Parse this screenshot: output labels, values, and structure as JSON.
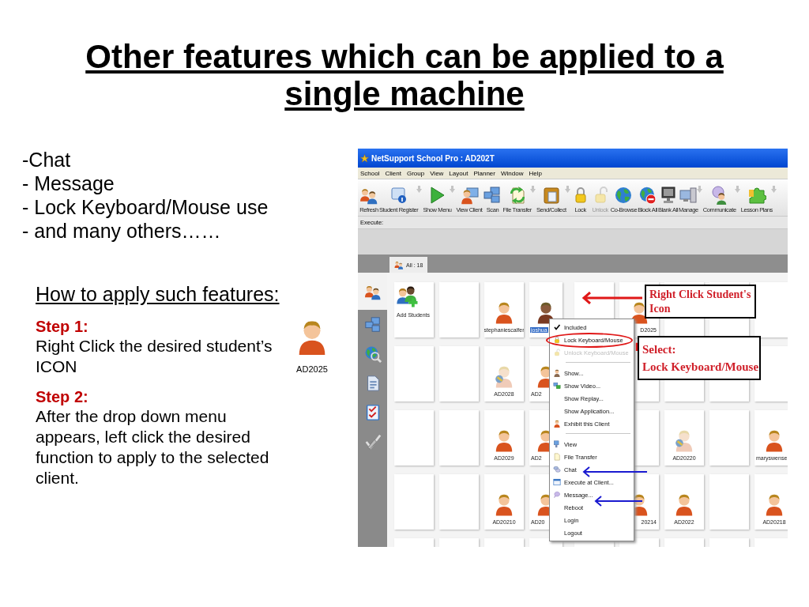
{
  "slide": {
    "title": "Other features which can be applied to a single machine",
    "bullets": [
      "-Chat",
      "- Message",
      "- Lock Keyboard/Mouse use",
      "- and many others……"
    ],
    "howto": "How to apply such features:",
    "steps": [
      {
        "heading": "Step 1:",
        "text": "Right Click the desired student’s\nICON"
      },
      {
        "heading": "Step 2:",
        "text": "After the drop down menu\nappears, left click the desired\nfunction to apply to the selected\nclient."
      }
    ],
    "example": {
      "label": "AD2025"
    }
  },
  "app": {
    "window": {
      "title": "NetSupport School Pro : AD202T"
    },
    "menu": [
      "School",
      "Client",
      "Group",
      "View",
      "Layout",
      "Planner",
      "Window",
      "Help"
    ],
    "toolbar": [
      {
        "label": "Refresh",
        "kind": "people",
        "dropdown": false,
        "disabled": false
      },
      {
        "label": "Student Register",
        "kind": "register",
        "dropdown": true,
        "disabled": false
      },
      {
        "label": "Show Menu",
        "kind": "play",
        "dropdown": true,
        "disabled": false
      },
      {
        "label": "View Client",
        "kind": "client",
        "dropdown": false,
        "disabled": false
      },
      {
        "label": "Scan",
        "kind": "scan",
        "dropdown": false,
        "disabled": false
      },
      {
        "label": "File Transfer",
        "kind": "filetransfer",
        "dropdown": true,
        "disabled": false
      },
      {
        "label": "Send/Collect",
        "kind": "sendcollect",
        "dropdown": true,
        "disabled": false
      },
      {
        "label": "Lock",
        "kind": "lock",
        "dropdown": false,
        "disabled": false
      },
      {
        "label": "Unlock",
        "kind": "unlock",
        "dropdown": false,
        "disabled": true
      },
      {
        "label": "Co-Browse",
        "kind": "globe",
        "dropdown": false,
        "disabled": false
      },
      {
        "label": "Block All",
        "kind": "block",
        "dropdown": false,
        "disabled": false
      },
      {
        "label": "Blank All",
        "kind": "monitor",
        "dropdown": false,
        "disabled": false
      },
      {
        "label": "Manage",
        "kind": "manage",
        "dropdown": true,
        "disabled": false
      },
      {
        "label": "Communicate",
        "kind": "communicate",
        "dropdown": true,
        "disabled": false
      },
      {
        "label": "Lesson Plans",
        "kind": "lesson",
        "dropdown": true,
        "disabled": false
      }
    ],
    "execute": {
      "label": "Execute:"
    },
    "tabs": [
      {
        "label": "All : 18",
        "selected": true
      }
    ],
    "sidebar": [
      {
        "kind": "people",
        "selected": true
      },
      {
        "kind": "scan",
        "selected": false
      },
      {
        "kind": "search",
        "selected": false
      },
      {
        "kind": "document",
        "selected": false
      },
      {
        "kind": "checklist",
        "selected": false
      },
      {
        "kind": "pen",
        "selected": false
      }
    ],
    "grid": [
      {
        "tiles": [
          {
            "kind": "add",
            "label": "Add Students",
            "selected": false
          },
          {
            "kind": "empty",
            "selected": false
          },
          {
            "kind": "student",
            "label": "stephaniescalfer",
            "selected": false
          },
          {
            "kind": "studentalt",
            "label": "joshua",
            "cut_right": true,
            "selected": true
          },
          {
            "kind": "empty",
            "selected": false
          },
          {
            "kind": "student",
            "label": "D2025",
            "cut_left": true,
            "selected": false
          },
          {
            "kind": "empty",
            "selected": false
          },
          {
            "kind": "empty",
            "selected": false
          },
          {
            "kind": "empty",
            "selected": false
          }
        ]
      },
      {
        "tiles": [
          {
            "kind": "empty",
            "selected": false
          },
          {
            "kind": "empty",
            "selected": false
          },
          {
            "kind": "offline",
            "label": "AD2028",
            "selected": false
          },
          {
            "kind": "student",
            "label": "AD2",
            "cut_right": true,
            "selected": false
          },
          {
            "kind": "hidden"
          },
          {
            "kind": "empty",
            "selected": false
          },
          {
            "kind": "empty",
            "selected": false
          },
          {
            "kind": "empty",
            "selected": false
          },
          {
            "kind": "empty",
            "selected": false
          }
        ]
      },
      {
        "tiles": [
          {
            "kind": "empty",
            "selected": false
          },
          {
            "kind": "empty",
            "selected": false
          },
          {
            "kind": "student",
            "label": "AD2029",
            "selected": false
          },
          {
            "kind": "student",
            "label": "AD2",
            "cut_right": true,
            "selected": false
          },
          {
            "kind": "hidden"
          },
          {
            "kind": "empty",
            "selected": false
          },
          {
            "kind": "offline",
            "label": "AD20220",
            "selected": false
          },
          {
            "kind": "empty",
            "selected": false
          },
          {
            "kind": "student",
            "label": "maryswense",
            "cut_right": true,
            "selected": false
          }
        ]
      },
      {
        "tiles": [
          {
            "kind": "empty",
            "selected": false
          },
          {
            "kind": "empty",
            "selected": false
          },
          {
            "kind": "student",
            "label": "AD20210",
            "selected": false
          },
          {
            "kind": "student",
            "label": "AD20",
            "cut_right": true,
            "selected": false
          },
          {
            "kind": "hidden"
          },
          {
            "kind": "student",
            "label": "20214",
            "cut_left": true,
            "selected": false
          },
          {
            "kind": "student",
            "label": "AD2022",
            "selected": false
          },
          {
            "kind": "empty",
            "selected": false
          },
          {
            "kind": "student",
            "label": "AD20218",
            "selected": false
          }
        ]
      },
      {
        "tiles": [
          {
            "kind": "empty",
            "selected": false
          },
          {
            "kind": "empty",
            "selected": false
          },
          {
            "kind": "empty",
            "selected": false
          },
          {
            "kind": "empty",
            "selected": false
          },
          {
            "kind": "empty",
            "selected": false
          },
          {
            "kind": "empty",
            "selected": false
          },
          {
            "kind": "empty",
            "selected": false
          },
          {
            "kind": "empty",
            "selected": false
          },
          {
            "kind": "empty",
            "selected": false
          }
        ]
      }
    ],
    "context_menu": [
      {
        "kind": "plain",
        "label": "Included",
        "checked": true,
        "disabled": false,
        "circled": false
      },
      {
        "kind": "lock",
        "label": "Lock Keyboard/Mouse",
        "checked": false,
        "disabled": false,
        "circled": true
      },
      {
        "kind": "unlock",
        "label": "Unlock Keyboard/Mouse",
        "checked": false,
        "disabled": true
      },
      {
        "kind": "separator"
      },
      {
        "kind": "show",
        "label": "Show...",
        "checked": false,
        "disabled": false
      },
      {
        "kind": "video",
        "label": "Show Video...",
        "checked": false,
        "disabled": false
      },
      {
        "kind": "plain",
        "label": "Show Replay...",
        "checked": false,
        "disabled": false
      },
      {
        "kind": "plain",
        "label": "Show Application...",
        "checked": false,
        "disabled": false
      },
      {
        "kind": "exhibit",
        "label": "Exhibit this Client",
        "checked": false,
        "disabled": false
      },
      {
        "kind": "separator"
      },
      {
        "kind": "view",
        "label": "View",
        "checked": false,
        "disabled": false
      },
      {
        "kind": "file",
        "label": "File Transfer",
        "checked": false,
        "disabled": false
      },
      {
        "kind": "chat",
        "label": "Chat",
        "checked": false,
        "disabled": false
      },
      {
        "kind": "execute",
        "label": "Execute at Client...",
        "checked": false,
        "disabled": false
      },
      {
        "kind": "message",
        "label": "Message...",
        "checked": false,
        "disabled": false
      },
      {
        "kind": "plain",
        "label": "Reboot",
        "checked": false,
        "disabled": false
      },
      {
        "kind": "plain",
        "label": "Login",
        "checked": false,
        "disabled": false
      },
      {
        "kind": "plain",
        "label": "Logout",
        "checked": false,
        "disabled": false
      }
    ],
    "callouts": [
      {
        "lines": [
          "Right Click Student's",
          "Icon"
        ]
      },
      {
        "lines": [
          "Select:",
          "Lock Keyboard/Mouse"
        ]
      }
    ]
  }
}
